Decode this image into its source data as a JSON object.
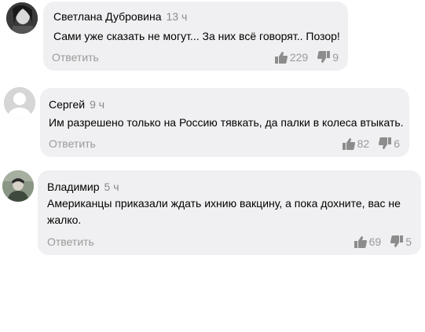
{
  "comments": [
    {
      "author": "Светлана Дубровина",
      "time": "13 ч",
      "text": "Сами уже сказать не могут... За них всё говорят.. Позор!",
      "reply": "Ответить",
      "likes": "229",
      "dislikes": "9"
    },
    {
      "author": "Сергей",
      "time": "9 ч",
      "text": "Им разрешено только на Россию тявкать, да палки в колеса втыкать.",
      "reply": "Ответить",
      "likes": "82",
      "dislikes": "6"
    },
    {
      "author": "Владимир",
      "time": "5 ч",
      "text": "Американцы приказали ждать ихнию вакцину, а пока дохните, вас не жалко.",
      "reply": "Ответить",
      "likes": "69",
      "dislikes": "5"
    }
  ],
  "colors": {
    "bubble": "#f0f0f2",
    "muted": "#9a9a9a",
    "icon": "#8c8c8c"
  }
}
